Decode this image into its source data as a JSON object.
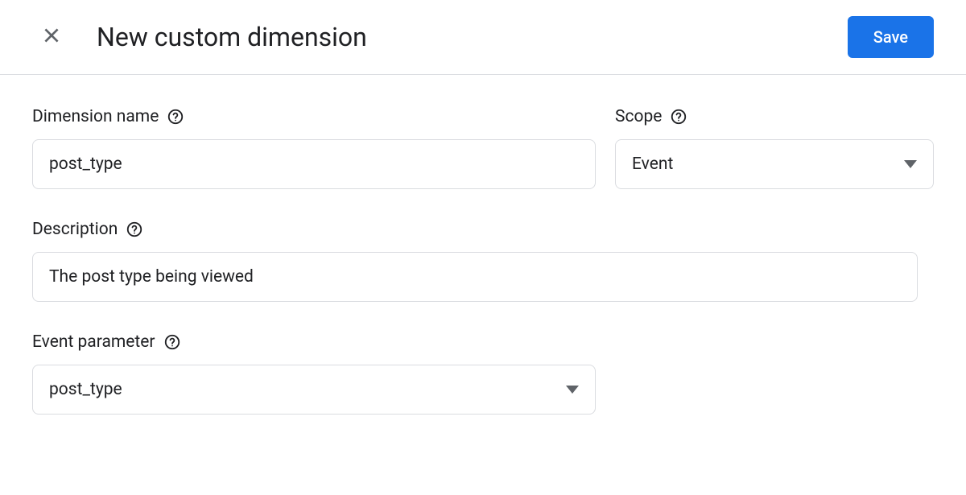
{
  "header": {
    "title": "New custom dimension",
    "save_label": "Save"
  },
  "form": {
    "dimension_name": {
      "label": "Dimension name",
      "value": "post_type"
    },
    "scope": {
      "label": "Scope",
      "selected": "Event"
    },
    "description": {
      "label": "Description",
      "value": "The post type being viewed"
    },
    "event_parameter": {
      "label": "Event parameter",
      "selected": "post_type"
    }
  }
}
